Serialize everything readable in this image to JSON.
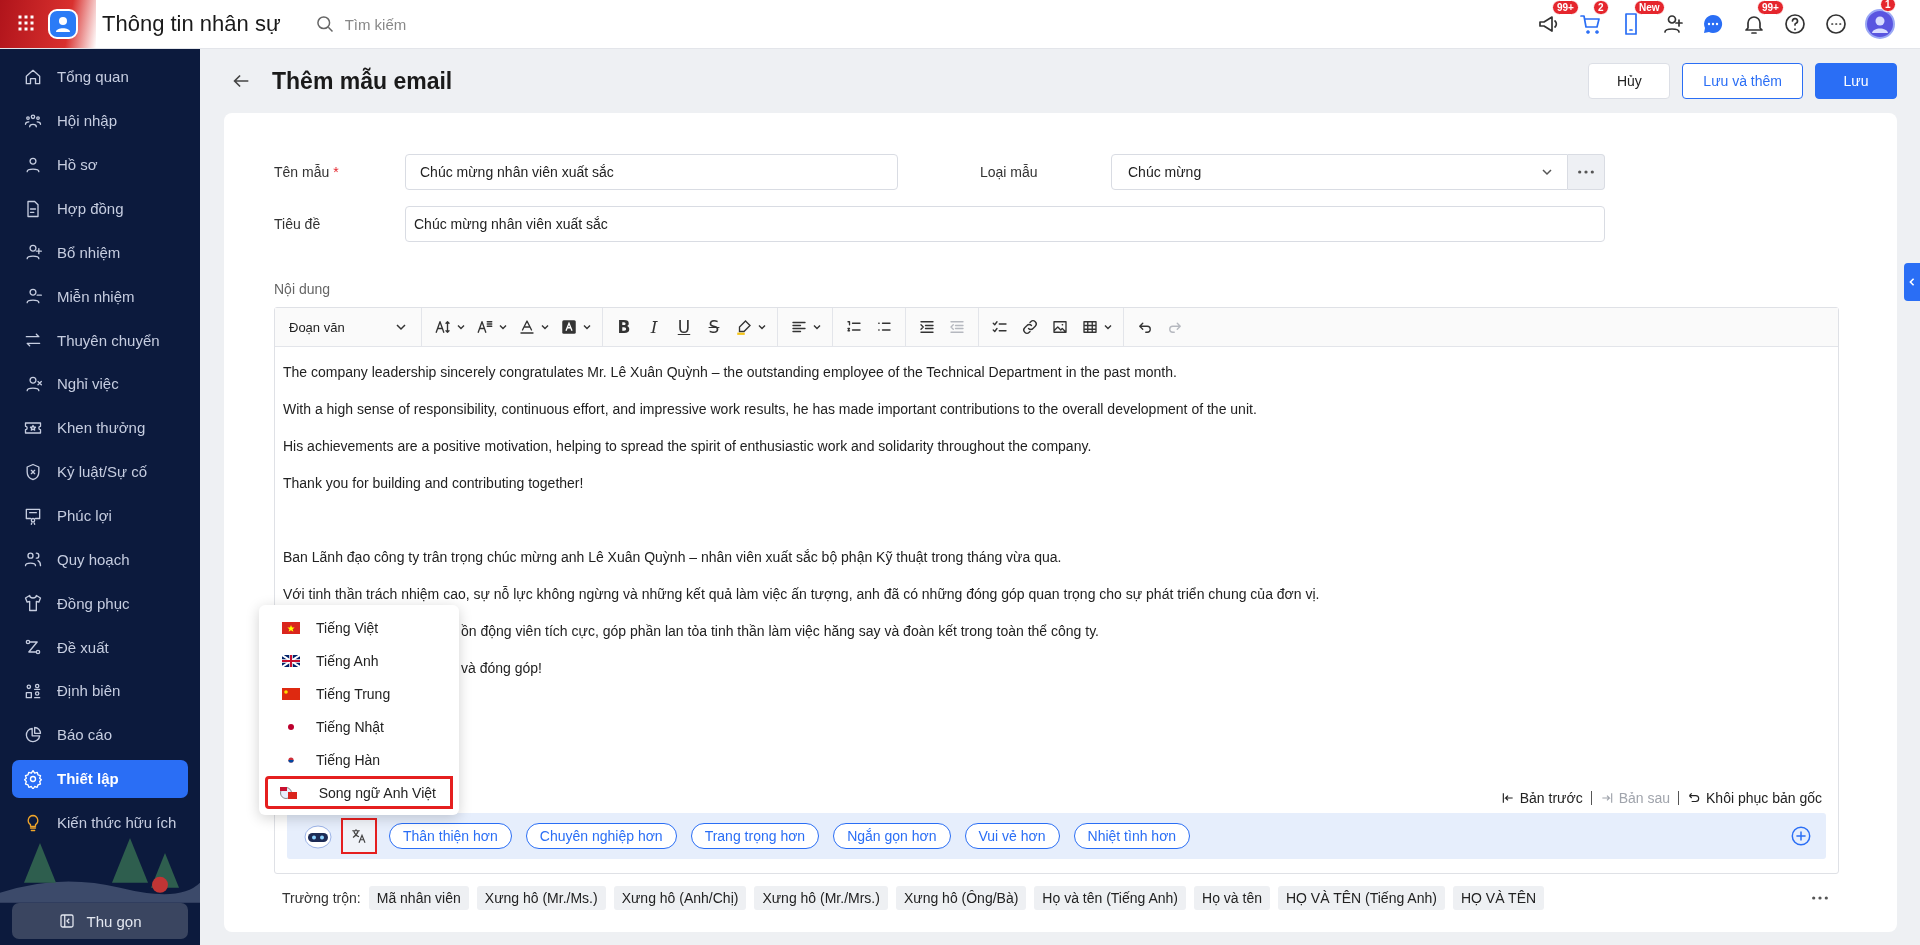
{
  "app": {
    "title": "Thông tin nhân sự",
    "search": {
      "placeholder": "Tìm kiếm"
    }
  },
  "top_icons": [
    {
      "kind": "megaphone",
      "badge": "99+"
    },
    {
      "kind": "cart",
      "badge": "2"
    },
    {
      "kind": "phone",
      "badge": "New"
    },
    {
      "kind": "add-user"
    },
    {
      "kind": "chat"
    },
    {
      "kind": "bell",
      "badge": "99+"
    },
    {
      "kind": "help"
    },
    {
      "kind": "more"
    },
    {
      "kind": "avatar",
      "badge": "1"
    }
  ],
  "sidebar": {
    "items": [
      {
        "label": "Tổng quan",
        "kind": "home",
        "selected": false
      },
      {
        "label": "Hội nhập",
        "kind": "team",
        "selected": false
      },
      {
        "label": "Hồ sơ",
        "kind": "person",
        "selected": false
      },
      {
        "label": "Hợp đồng",
        "kind": "document",
        "selected": false
      },
      {
        "label": "Bổ nhiệm",
        "kind": "person-plus",
        "selected": false
      },
      {
        "label": "Miễn nhiệm",
        "kind": "person-minus",
        "selected": false
      },
      {
        "label": "Thuyên chuyển",
        "kind": "swap",
        "selected": false
      },
      {
        "label": "Nghỉ việc",
        "kind": "person-x",
        "selected": false
      },
      {
        "label": "Khen thưởng",
        "kind": "ticket",
        "selected": false
      },
      {
        "label": "Kỷ luật/Sự cố",
        "kind": "shield",
        "selected": false
      },
      {
        "label": "Phúc lợi",
        "kind": "certificate",
        "selected": false
      },
      {
        "label": "Quy hoạch",
        "kind": "people",
        "selected": false
      },
      {
        "label": "Đồng phục",
        "kind": "shirt",
        "selected": false
      },
      {
        "label": "Đề xuất",
        "kind": "route",
        "selected": false
      },
      {
        "label": "Định biên",
        "kind": "org",
        "selected": false
      },
      {
        "label": "Báo cáo",
        "kind": "pie",
        "selected": false
      },
      {
        "label": "Thiết lập",
        "kind": "gear",
        "selected": true
      },
      {
        "label": "Kiến thức hữu ích",
        "kind": "bulb",
        "selected": false
      }
    ],
    "collapse_button": "Thu gọn"
  },
  "page": {
    "title": "Thêm mẫu email",
    "buttons": [
      {
        "label": "Hủy",
        "kind": "plain"
      },
      {
        "label": "Lưu và thêm",
        "kind": "outline"
      },
      {
        "label": "Lưu",
        "kind": "primary"
      }
    ]
  },
  "form": {
    "name": {
      "label": "Tên mẫu",
      "required_mark": "*",
      "value": "Chúc mừng nhân viên xuất sắc"
    },
    "type": {
      "label": "Loại mẫu",
      "value": "Chúc mừng"
    },
    "subject": {
      "label": "Tiêu đề",
      "value": "Chúc mừng nhân viên xuất sắc"
    },
    "content_label": "Nội dung"
  },
  "editor": {
    "paragraph_style": "Đoạn văn",
    "format_buttons": [
      {
        "kind": "bold",
        "label": "B"
      },
      {
        "kind": "italic",
        "label": "I"
      },
      {
        "kind": "underline",
        "label": "U"
      },
      {
        "kind": "strike",
        "label": "S"
      }
    ],
    "outdent_disabled": true,
    "redo_disabled": true,
    "english": [
      "The company leadership sincerely congratulates Mr. Lê Xuân Quỳnh – the outstanding employee of the Technical Department in the past month.",
      "With a high sense of responsibility, continuous effort, and impressive work results, he has made important contributions to the overall development of the unit.",
      "His achievements are a positive motivation, helping to spread the spirit of enthusiastic work and solidarity throughout the company.",
      "Thank you for building and contributing together!"
    ],
    "vietnamese": [
      "Ban Lãnh đạo công ty trân trọng chúc mừng anh Lê Xuân Quỳnh – nhân viên xuất sắc bộ phận Kỹ thuật trong tháng vừa qua.",
      "Với tinh thần trách nhiệm cao, sự nỗ lực không ngừng và những kết quả làm việc ấn tượng, anh đã có những đóng góp quan trọng cho sự phát triển chung của đơn vị.",
      "ồn động viên tích cực, góp phần lan tỏa tinh thần làm việc hăng say và đoàn kết trong toàn thể công ty.",
      "và đóng góp!"
    ],
    "history": [
      {
        "label": "Bản trước",
        "kind": "previous",
        "disabled": false
      },
      {
        "label": "Bản sau",
        "kind": "next",
        "disabled": true
      },
      {
        "label": "Khôi phục bản gốc",
        "kind": "restore",
        "disabled": false
      }
    ],
    "language_menu": {
      "open": true,
      "items": [
        {
          "label": "Tiếng Việt",
          "kind": "vn",
          "selected": false
        },
        {
          "label": "Tiếng Anh",
          "kind": "uk",
          "selected": false
        },
        {
          "label": "Tiếng Trung",
          "kind": "cn",
          "selected": false
        },
        {
          "label": "Tiếng Nhật",
          "kind": "jp",
          "selected": false
        },
        {
          "label": "Tiếng Hàn",
          "kind": "kr",
          "selected": false
        },
        {
          "label": "Song ngữ Anh Việt",
          "kind": "bilingual",
          "selected": true
        }
      ]
    },
    "ai_bar": {
      "translate_active": true,
      "chips": [
        "Thân thiện hơn",
        "Chuyên nghiệp hơn",
        "Trang trọng hơn",
        "Ngắn gọn hơn",
        "Vui vẻ hơn",
        "Nhiệt tình hơn"
      ]
    }
  },
  "merge_fields": {
    "label": "Trường trộn:",
    "items": [
      "Mã nhân viên",
      "Xưng hô (Mr./Ms.)",
      "Xưng hô (Anh/Chị)",
      "Xưng hô (Mr./Mrs.)",
      "Xưng hô (Ông/Bà)",
      "Họ và tên (Tiếng Anh)",
      "Họ và tên",
      "HỌ VÀ TÊN (Tiếng Anh)",
      "HỌ VÀ TÊN"
    ]
  }
}
